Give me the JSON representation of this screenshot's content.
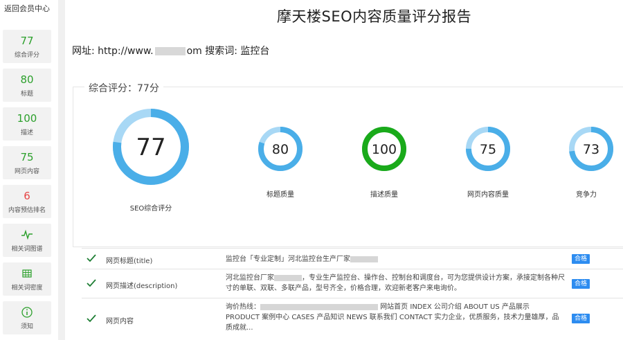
{
  "sidebar": {
    "back_label": "返回会员中心",
    "items": [
      {
        "value": "77",
        "label": "综合评分"
      },
      {
        "value": "80",
        "label": "标题"
      },
      {
        "value": "100",
        "label": "描述"
      },
      {
        "value": "75",
        "label": "网页内容"
      },
      {
        "value": "6",
        "label": "内容预估排名"
      },
      {
        "icon": "pulse-icon",
        "label": "相关词图谱"
      },
      {
        "icon": "grid-icon",
        "label": "相关词密度"
      },
      {
        "icon": "info-icon",
        "label": "须知"
      }
    ]
  },
  "header": {
    "title": "摩天楼SEO内容质量评分报告",
    "url_label": "网址:",
    "url_prefix": "http://www.",
    "url_suffix": "om",
    "keyword_label": "搜索词:",
    "keyword": "监控台"
  },
  "summary": {
    "legend": "综合评分：77分",
    "gauges": [
      {
        "value": 77,
        "label": "SEO综合评分",
        "color": "#4aaee8"
      },
      {
        "value": 80,
        "label": "标题质量",
        "color": "#4aaee8"
      },
      {
        "value": 100,
        "label": "描述质量",
        "color": "#1aaa1a"
      },
      {
        "value": 75,
        "label": "网页内容质量",
        "color": "#4aaee8"
      },
      {
        "value": 73,
        "label": "竞争力",
        "color": "#4aaee8"
      }
    ]
  },
  "table": {
    "rows": [
      {
        "name": "网页标题(title)",
        "content_a": "监控台「专业定制」河北监控台生产厂家",
        "content_b": "",
        "badge": "合格"
      },
      {
        "name": "网页描述(description)",
        "content_a": "河北监控台厂家",
        "content_b": "，专业生产监控台、操作台、控制台和调度台，可为您提供设计方案，承接定制各种尺寸的单联、双联、多联产品，型号齐全，价格合理，欢迎新老客户来电询价。",
        "badge": "合格"
      },
      {
        "name": "网页内容",
        "content_a": "询价热线：",
        "content_b": "网站首页 INDEX 公司介绍 ABOUT US 产品展示 PRODUCT 案例中心 CASES 产品知识 NEWS 联系我们 CONTACT 实力企业，优质服务，技术力量雄厚，品质成就...",
        "badge": "合格"
      }
    ]
  },
  "colors": {
    "accent": "#4aaee8",
    "pass": "#1aaa1a",
    "badge": "#2d8cf0",
    "warn": "#e64545"
  }
}
